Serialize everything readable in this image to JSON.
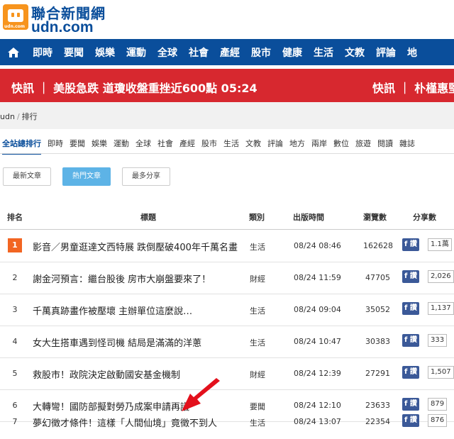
{
  "header": {
    "logo_cn": "聯合新聞網",
    "logo_en": "udn.com",
    "logo_mini": "udn.com"
  },
  "nav": {
    "items": [
      "即時",
      "要聞",
      "娛樂",
      "運動",
      "全球",
      "社會",
      "產經",
      "股市",
      "健康",
      "生活",
      "文教",
      "評論",
      "地"
    ]
  },
  "alert": {
    "left": "快訊 ｜ 美股急跌 道瓊收盤重挫近600點 05:24",
    "right": "快訊 ｜ 朴槿惠堅"
  },
  "breadcrumb": {
    "home": "udn",
    "sep": "/",
    "current": "排行"
  },
  "categories": [
    "全站總排行",
    "即時",
    "要聞",
    "娛樂",
    "運動",
    "全球",
    "社會",
    "產經",
    "股市",
    "生活",
    "文教",
    "評論",
    "地方",
    "兩岸",
    "數位",
    "旅遊",
    "閱讀",
    "雜誌"
  ],
  "sort_buttons": [
    "最新文章",
    "熱門文章",
    "最多分享"
  ],
  "table": {
    "headers": {
      "rank": "排名",
      "title": "標題",
      "category": "類別",
      "time": "出版時間",
      "views": "瀏覽數",
      "shares": "分享數"
    },
    "fb_label": "f 讚",
    "rows": [
      {
        "rank": "1",
        "title": "影音／男童逛達文西特展 跌倒壓破400年千萬名畫",
        "category": "生活",
        "time": "08/24 08:46",
        "views": "162628",
        "shares": "1.1萬"
      },
      {
        "rank": "2",
        "title": "謝金河預言：繼台股後 房市大崩盤要來了！",
        "category": "財經",
        "time": "08/24 11:59",
        "views": "47705",
        "shares": "2,026"
      },
      {
        "rank": "3",
        "title": "千萬真跡畫作被壓壞 主辦單位這麼說…",
        "category": "生活",
        "time": "08/24 09:04",
        "views": "35052",
        "shares": "1,137"
      },
      {
        "rank": "4",
        "title": "女大生搭車遇到怪司機 結局是滿滿的洋蔥",
        "category": "生活",
        "time": "08/24 10:47",
        "views": "30383",
        "shares": "333"
      },
      {
        "rank": "5",
        "title": "救股市！政院決定啟動國安基金機制",
        "category": "財經",
        "time": "08/24 12:39",
        "views": "27291",
        "shares": "1,507"
      },
      {
        "rank": "6",
        "title": "大轉彎！國防部擬對勞乃成案申請再議",
        "category": "要聞",
        "time": "08/24 12:10",
        "views": "23633",
        "shares": "879"
      },
      {
        "rank": "7",
        "title": "夢幻徵才條件！這樣「人間仙境」竟徵不到人",
        "category": "生活",
        "time": "08/24 13:07",
        "views": "22354",
        "shares": "876"
      }
    ]
  },
  "colors": {
    "brand_blue": "#0a4e9b",
    "alert_red": "#d7282f",
    "rank_orange": "#f26522",
    "fb_blue": "#3b5998",
    "active_button": "#5db3e6",
    "arrow_red": "#e3101c"
  }
}
